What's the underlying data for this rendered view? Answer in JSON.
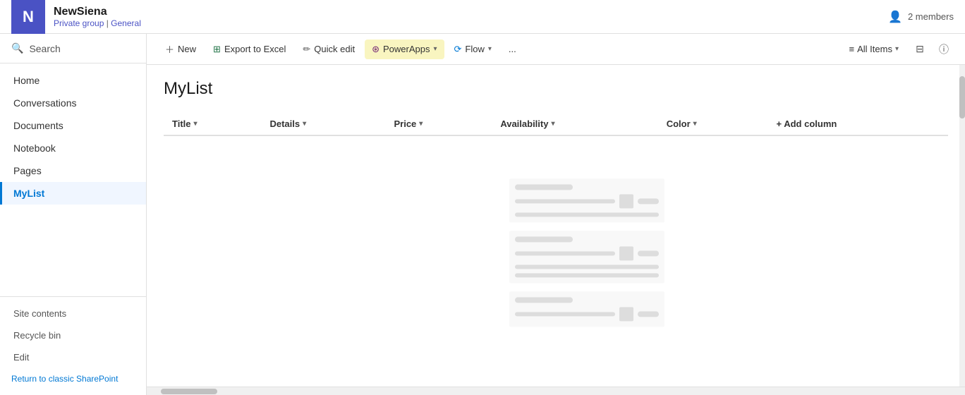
{
  "header": {
    "logo_letter": "N",
    "site_name": "NewSiena",
    "site_type": "Private group",
    "site_section": "General",
    "members_label": "2 members"
  },
  "search": {
    "label": "Search"
  },
  "sidebar": {
    "nav_items": [
      {
        "id": "home",
        "label": "Home",
        "active": false
      },
      {
        "id": "conversations",
        "label": "Conversations",
        "active": false
      },
      {
        "id": "documents",
        "label": "Documents",
        "active": false
      },
      {
        "id": "notebook",
        "label": "Notebook",
        "active": false
      },
      {
        "id": "pages",
        "label": "Pages",
        "active": false
      },
      {
        "id": "mylist",
        "label": "MyList",
        "active": true
      }
    ],
    "footer_items": [
      {
        "id": "site-contents",
        "label": "Site contents"
      },
      {
        "id": "recycle-bin",
        "label": "Recycle bin"
      },
      {
        "id": "edit",
        "label": "Edit"
      }
    ],
    "return_label": "Return to classic SharePoint"
  },
  "toolbar": {
    "new_label": "New",
    "export_label": "Export to Excel",
    "quick_edit_label": "Quick edit",
    "powerapps_label": "PowerApps",
    "flow_label": "Flow",
    "more_label": "...",
    "view_label": "All Items",
    "filter_icon": "≡",
    "info_icon": "ⓘ"
  },
  "list": {
    "title": "MyList",
    "columns": [
      {
        "id": "title",
        "label": "Title"
      },
      {
        "id": "details",
        "label": "Details"
      },
      {
        "id": "price",
        "label": "Price"
      },
      {
        "id": "availability",
        "label": "Availability"
      },
      {
        "id": "color",
        "label": "Color"
      }
    ],
    "add_column_label": "+ Add column"
  }
}
